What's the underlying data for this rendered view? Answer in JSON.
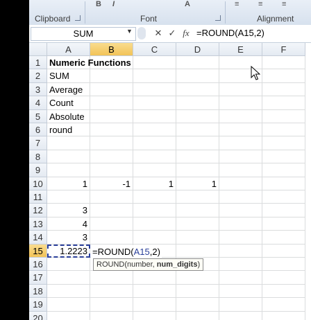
{
  "ribbon": {
    "groups": [
      {
        "label": "Clipboard"
      },
      {
        "label": "Font"
      },
      {
        "label": "Alignment"
      }
    ]
  },
  "formula_bar": {
    "name_box": "SUM",
    "cancel_label": "✕",
    "enter_label": "✓",
    "fx_label": "fx",
    "formula": "=ROUND(A15,2)"
  },
  "columns": [
    "A",
    "B",
    "C",
    "D",
    "E",
    "F"
  ],
  "rows": [
    {
      "n": "1",
      "cells": [
        "Numeric Functions",
        "",
        "",
        "",
        "",
        ""
      ]
    },
    {
      "n": "2",
      "cells": [
        "SUM",
        "",
        "",
        "",
        "",
        ""
      ]
    },
    {
      "n": "3",
      "cells": [
        "Average",
        "",
        "",
        "",
        "",
        ""
      ]
    },
    {
      "n": "4",
      "cells": [
        "Count",
        "",
        "",
        "",
        "",
        ""
      ]
    },
    {
      "n": "5",
      "cells": [
        "Absolute",
        "",
        "",
        "",
        "",
        ""
      ]
    },
    {
      "n": "6",
      "cells": [
        "round",
        "",
        "",
        "",
        "",
        ""
      ]
    },
    {
      "n": "7",
      "cells": [
        "",
        "",
        "",
        "",
        "",
        ""
      ]
    },
    {
      "n": "8",
      "cells": [
        "",
        "",
        "",
        "",
        "",
        ""
      ]
    },
    {
      "n": "9",
      "cells": [
        "",
        "",
        "",
        "",
        "",
        ""
      ]
    },
    {
      "n": "10",
      "cells": [
        "1",
        "-1",
        "1",
        "1",
        "",
        ""
      ]
    },
    {
      "n": "11",
      "cells": [
        "",
        "",
        "",
        "",
        "",
        ""
      ]
    },
    {
      "n": "12",
      "cells": [
        "3",
        "",
        "",
        "",
        "",
        ""
      ]
    },
    {
      "n": "13",
      "cells": [
        "4",
        "",
        "",
        "",
        "",
        ""
      ]
    },
    {
      "n": "14",
      "cells": [
        "3",
        "",
        "",
        "",
        "",
        ""
      ]
    },
    {
      "n": "15",
      "cells": [
        "1.2223",
        "",
        "",
        "",
        "",
        ""
      ]
    },
    {
      "n": "16",
      "cells": [
        "",
        "",
        "",
        "",
        "",
        ""
      ]
    },
    {
      "n": "17",
      "cells": [
        "",
        "",
        "",
        "",
        "",
        ""
      ]
    },
    {
      "n": "18",
      "cells": [
        "",
        "",
        "",
        "",
        "",
        ""
      ]
    },
    {
      "n": "19",
      "cells": [
        "",
        "",
        "",
        "",
        "",
        ""
      ]
    },
    {
      "n": "20",
      "cells": [
        "",
        "",
        "",
        "",
        "",
        ""
      ]
    }
  ],
  "numeric_rows": [
    "10",
    "12",
    "13",
    "14",
    "15"
  ],
  "selected_column": "B",
  "selected_row": "15",
  "edit": {
    "prefix": "=ROUND(",
    "ref": "A15",
    "suffix": ",2)"
  },
  "tooltip": {
    "func": "ROUND(number, ",
    "arg": "num_digits",
    "close": ")"
  },
  "colors": {
    "accent_select": "#f2c357",
    "ref_color": "#2a3f9a",
    "header_bg": "#e4eaf2"
  }
}
